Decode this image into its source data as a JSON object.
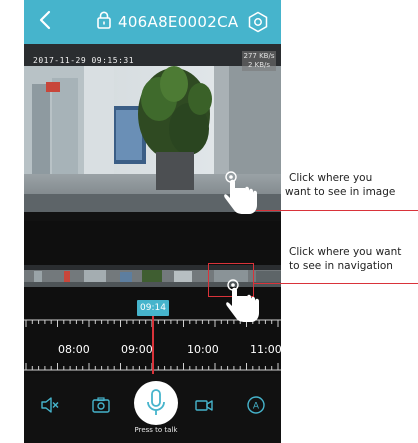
{
  "header": {
    "title": "406A8E0002CA",
    "back_icon": "chevron-left-icon",
    "lock_icon": "lock-icon",
    "settings_icon": "gear-icon"
  },
  "video": {
    "timestamp": "2017-11-29 09:15:31",
    "bitrate_line1": "277 KB/s",
    "bitrate_line2": "2 KB/s"
  },
  "timeline": {
    "current_time": "09:14",
    "labels": [
      "08:00",
      "09:00",
      "10:00",
      "11:00"
    ]
  },
  "controls": {
    "mute_icon": "speaker-mute-icon",
    "snapshot_icon": "camera-icon",
    "talk_icon": "microphone-icon",
    "record_icon": "video-record-icon",
    "auto_icon": "auto-a-icon",
    "talk_label": "Press to talk"
  },
  "annotations": {
    "image_click_line1": "Click where you",
    "image_click_line2": "want to see in image",
    "nav_click_line1": "Click where you want",
    "nav_click_line2": "to see in navigation"
  },
  "colors": {
    "header": "#46b4cc",
    "accent_red": "#d9333a",
    "background": "#0f0f0f"
  }
}
